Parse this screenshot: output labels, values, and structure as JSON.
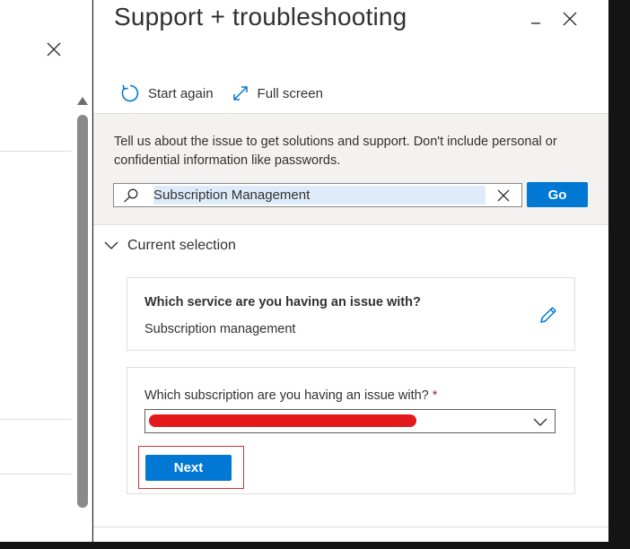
{
  "panel": {
    "title": "Support + troubleshooting"
  },
  "toolbar": {
    "start_again_label": "Start again",
    "full_screen_label": "Full screen"
  },
  "info": {
    "text": "Tell us about the issue to get solutions and support. Don't include personal or confidential information like passwords."
  },
  "search": {
    "value": "Subscription Management",
    "go_label": "Go"
  },
  "current_selection": {
    "title": "Current selection",
    "service_question": "Which service are you having an issue with?",
    "service_answer": "Subscription management",
    "subscription_question": "Which subscription are you having an issue with?",
    "required_marker": "*",
    "next_label": "Next"
  },
  "colors": {
    "accent": "#0078d4",
    "redaction": "#e3191c",
    "highlight": "#d13438"
  }
}
